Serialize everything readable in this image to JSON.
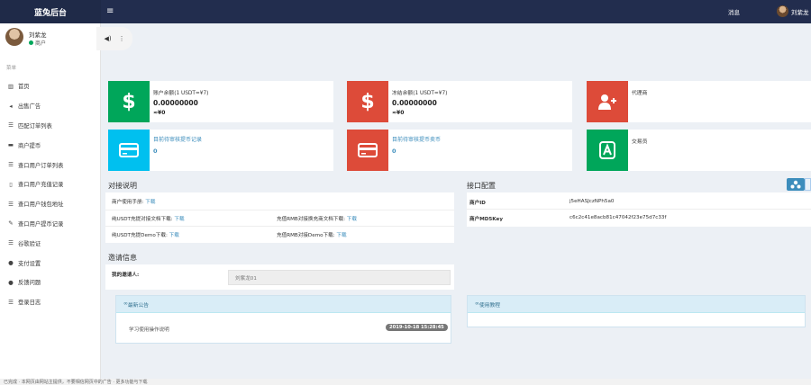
{
  "colors": {
    "topbar": "#222d4e",
    "green": "#00a65a",
    "red": "#dd4b39",
    "aqua": "#00c0ef",
    "link": "#3c8dbc"
  },
  "header": {
    "brand": "蓝兔后台",
    "menu_icon": "hamburger-icon",
    "messages": "消息",
    "user": "刘紫龙"
  },
  "watermark": "https://www.huzhan.com/ishop33067",
  "sidebar": {
    "profile_name": "刘紫龙",
    "profile_role": "商户",
    "section_label": "菜单",
    "popover_icons": [
      "volume-icon",
      "more-vertical-icon"
    ],
    "items": [
      {
        "label": "首页",
        "icon": "bar-chart-icon",
        "glyph": "▥"
      },
      {
        "label": "出售广告",
        "icon": "megaphone-icon",
        "glyph": "◂"
      },
      {
        "label": "匹配订单列表",
        "icon": "list-icon",
        "glyph": "☰"
      },
      {
        "label": "商户提币",
        "icon": "card-icon",
        "glyph": "▬"
      },
      {
        "label": "查口用户订单列表",
        "icon": "list-icon",
        "glyph": "☰"
      },
      {
        "label": "查口用户充值记录",
        "icon": "file-icon",
        "glyph": "▯"
      },
      {
        "label": "查口用户钱包地址",
        "icon": "list-icon",
        "glyph": "☰"
      },
      {
        "label": "查口用户提币记录",
        "icon": "edit-icon",
        "glyph": "✎"
      },
      {
        "label": "谷歌验证",
        "icon": "list-icon",
        "glyph": "☰"
      },
      {
        "label": "支付设置",
        "icon": "gear-icon",
        "glyph": "●"
      },
      {
        "label": "反馈问题",
        "icon": "comment-icon",
        "glyph": "●"
      },
      {
        "label": "登录日志",
        "icon": "list-icon",
        "glyph": "☰"
      }
    ]
  },
  "stats": {
    "account_balance": {
      "label": "账户余额(1 USDT=¥7)",
      "value": "0.00000000",
      "cny": "≈¥0",
      "icon": "dollar-icon"
    },
    "frozen_balance": {
      "label": "冻结余额(1 USDT=¥7)",
      "value": "0.00000000",
      "cny": "≈¥0",
      "icon": "dollar-icon"
    },
    "agent": {
      "label": "代理商",
      "icon": "user-plus-icon"
    },
    "pending_withdraw_records": {
      "label": "目前待审核提币记录",
      "value": "0",
      "icon": "credit-card-icon"
    },
    "pending_withdraw_sell": {
      "label": "目前待审核提币卖币",
      "value": "0",
      "icon": "credit-card-icon"
    },
    "trader": {
      "label": "交易员",
      "icon": "android-icon"
    }
  },
  "integration": {
    "title": "对接说明",
    "manual_label": "商户使用手册:",
    "manual_link": "下载",
    "usdt_doc_label": "纯USDT充提对接文档下载:",
    "usdt_doc_link": "下载",
    "rmb_doc_label": "充值RMB对接换充商文档下载:",
    "rmb_doc_link": "下载",
    "usdt_demo_label": "纯USDT充提Demo下载:",
    "usdt_demo_link": "下载",
    "rmb_demo_label": "充值RMB对接Demo下载:",
    "rmb_demo_link": "下载"
  },
  "api_config": {
    "title": "接口配置",
    "rows": [
      {
        "key": "商户ID",
        "value": "j5eHASJczNPh5a0"
      },
      {
        "key": "商户MD5Key",
        "value": "c6c2c41e8acb81c47042f23e75d7c33f"
      }
    ],
    "tool_icon": "sitemap-icon"
  },
  "invite": {
    "title": "邀请信息",
    "label": "我的邀请人:",
    "value": "刘紫龙01"
  },
  "notice": {
    "title": "最新公告",
    "item": "学习使用操作说明",
    "date": "2019-10-18 15:28:45",
    "head_icon": "link-icon"
  },
  "tutorial": {
    "title": "使用教程",
    "head_icon": "link-icon"
  },
  "statusbar": {
    "text": "已完成  ·  本网页由网站主提供，不要相信网页中的广告  ·  更多功能与下载"
  }
}
